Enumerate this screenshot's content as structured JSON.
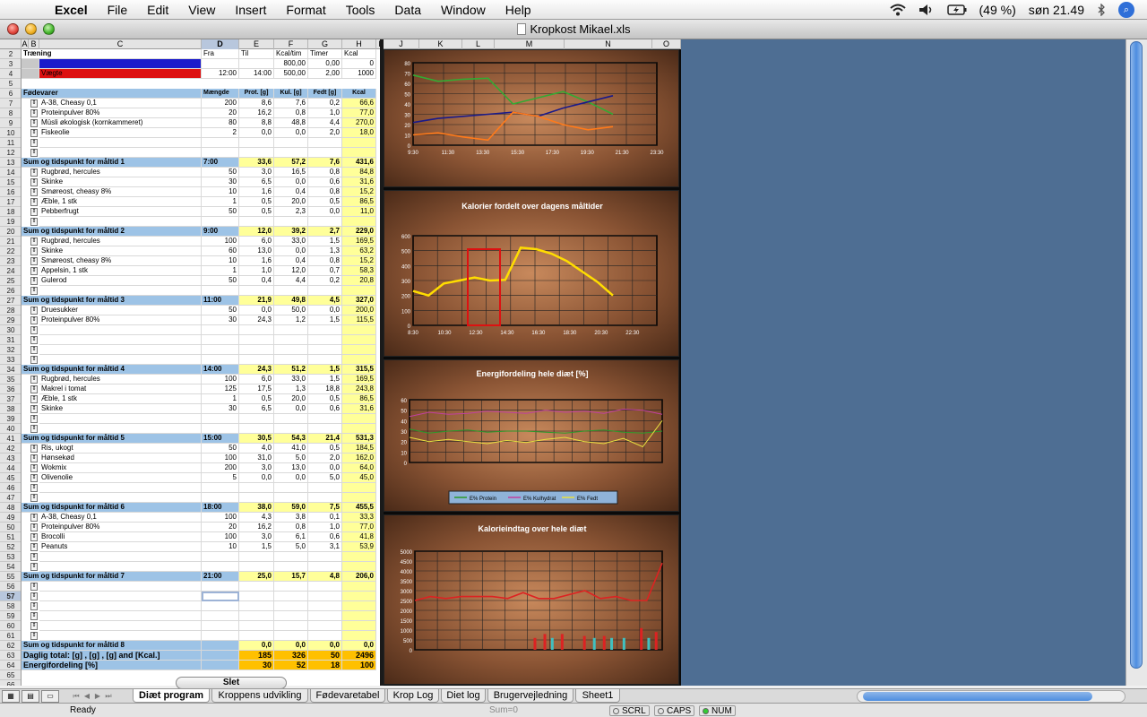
{
  "menubar": {
    "app": "Excel",
    "items": [
      "File",
      "Edit",
      "View",
      "Insert",
      "Format",
      "Tools",
      "Data",
      "Window",
      "Help"
    ],
    "battery": "(49 %)",
    "clock": "søn 21.49"
  },
  "window": {
    "title": "Kropkost Mikael.xls"
  },
  "columns": [
    "A",
    "B",
    "C",
    "D",
    "E",
    "F",
    "G",
    "H",
    "I",
    "J",
    "K",
    "L",
    "M",
    "N",
    "O"
  ],
  "training": {
    "label": "Træning",
    "headers": [
      "Fra",
      "Til",
      "Kcal/tim",
      "Timer",
      "Kcal"
    ],
    "row3": [
      "",
      "",
      "800,00",
      "0,00",
      "0"
    ],
    "row4_label": "Vægte",
    "row4": [
      "12:00",
      "14:00",
      "500,00",
      "2,00",
      "1000"
    ]
  },
  "food_header": {
    "label": "Fødevarer",
    "cols": [
      "Mængde",
      "Prot. [g]",
      "Kul. [g]",
      "Fedt [g]",
      "Kcal"
    ]
  },
  "rows": [
    {
      "r": 7,
      "name": "A-38, Cheasy 0,1",
      "d": "200",
      "e": "8,6",
      "f": "7,6",
      "g": "0,2",
      "h": "66,6"
    },
    {
      "r": 8,
      "name": "Proteinpulver 80%",
      "d": "20",
      "e": "16,2",
      "f": "0,8",
      "g": "1,0",
      "h": "77,0"
    },
    {
      "r": 9,
      "name": "Müsli økologisk (kornkammeret)",
      "d": "80",
      "e": "8,8",
      "f": "48,8",
      "g": "4,4",
      "h": "270,0"
    },
    {
      "r": 10,
      "name": "Fiskeolie",
      "d": "2",
      "e": "0,0",
      "f": "0,0",
      "g": "2,0",
      "h": "18,0"
    },
    {
      "r": 11,
      "name": "",
      "d": "",
      "e": "",
      "f": "",
      "g": "",
      "h": ""
    },
    {
      "r": 12,
      "name": "",
      "d": "",
      "e": "",
      "f": "",
      "g": "",
      "h": ""
    },
    {
      "r": 13,
      "hdr": true,
      "name": "Sum og tidspunkt for måltid 1",
      "d": "7:00",
      "e": "33,6",
      "f": "57,2",
      "g": "7,6",
      "h": "431,6"
    },
    {
      "r": 14,
      "name": "Rugbrød, hercules",
      "d": "50",
      "e": "3,0",
      "f": "16,5",
      "g": "0,8",
      "h": "84,8"
    },
    {
      "r": 15,
      "name": "Skinke",
      "d": "30",
      "e": "6,5",
      "f": "0,0",
      "g": "0,6",
      "h": "31,6"
    },
    {
      "r": 16,
      "name": "Smøreost, cheasy 8%",
      "d": "10",
      "e": "1,6",
      "f": "0,4",
      "g": "0,8",
      "h": "15,2"
    },
    {
      "r": 17,
      "name": "Æble, 1 stk",
      "d": "1",
      "e": "0,5",
      "f": "20,0",
      "g": "0,5",
      "h": "86,5"
    },
    {
      "r": 18,
      "name": "Pebberfrugt",
      "d": "50",
      "e": "0,5",
      "f": "2,3",
      "g": "0,0",
      "h": "11,0"
    },
    {
      "r": 19,
      "name": "",
      "d": "",
      "e": "",
      "f": "",
      "g": "",
      "h": ""
    },
    {
      "r": 20,
      "hdr": true,
      "name": "Sum og tidspunkt for måltid 2",
      "d": "9:00",
      "e": "12,0",
      "f": "39,2",
      "g": "2,7",
      "h": "229,0"
    },
    {
      "r": 21,
      "name": "Rugbrød, hercules",
      "d": "100",
      "e": "6,0",
      "f": "33,0",
      "g": "1,5",
      "h": "169,5"
    },
    {
      "r": 22,
      "name": "Skinke",
      "d": "60",
      "e": "13,0",
      "f": "0,0",
      "g": "1,3",
      "h": "63,2"
    },
    {
      "r": 23,
      "name": "Smøreost, cheasy 8%",
      "d": "10",
      "e": "1,6",
      "f": "0,4",
      "g": "0,8",
      "h": "15,2"
    },
    {
      "r": 24,
      "name": "Appelsin, 1 stk",
      "d": "1",
      "e": "1,0",
      "f": "12,0",
      "g": "0,7",
      "h": "58,3"
    },
    {
      "r": 25,
      "name": "Gulerod",
      "d": "50",
      "e": "0,4",
      "f": "4,4",
      "g": "0,2",
      "h": "20,8"
    },
    {
      "r": 26,
      "name": "",
      "d": "",
      "e": "",
      "f": "",
      "g": "",
      "h": ""
    },
    {
      "r": 27,
      "hdr": true,
      "name": "Sum og tidspunkt for måltid 3",
      "d": "11:00",
      "e": "21,9",
      "f": "49,8",
      "g": "4,5",
      "h": "327,0"
    },
    {
      "r": 28,
      "name": "Druesukker",
      "d": "50",
      "e": "0,0",
      "f": "50,0",
      "g": "0,0",
      "h": "200,0"
    },
    {
      "r": 29,
      "name": "Proteinpulver 80%",
      "d": "30",
      "e": "24,3",
      "f": "1,2",
      "g": "1,5",
      "h": "115,5"
    },
    {
      "r": 30,
      "name": "",
      "d": "",
      "e": "",
      "f": "",
      "g": "",
      "h": ""
    },
    {
      "r": 31,
      "name": "",
      "d": "",
      "e": "",
      "f": "",
      "g": "",
      "h": ""
    },
    {
      "r": 32,
      "name": "",
      "d": "",
      "e": "",
      "f": "",
      "g": "",
      "h": ""
    },
    {
      "r": 33,
      "name": "",
      "d": "",
      "e": "",
      "f": "",
      "g": "",
      "h": ""
    },
    {
      "r": 34,
      "hdr": true,
      "name": "Sum og tidspunkt for måltid 4",
      "d": "14:00",
      "e": "24,3",
      "f": "51,2",
      "g": "1,5",
      "h": "315,5"
    },
    {
      "r": 35,
      "name": "Rugbrød, hercules",
      "d": "100",
      "e": "6,0",
      "f": "33,0",
      "g": "1,5",
      "h": "169,5"
    },
    {
      "r": 36,
      "name": "Makrel i tomat",
      "d": "125",
      "e": "17,5",
      "f": "1,3",
      "g": "18,8",
      "h": "243,8"
    },
    {
      "r": 37,
      "name": "Æble, 1 stk",
      "d": "1",
      "e": "0,5",
      "f": "20,0",
      "g": "0,5",
      "h": "86,5"
    },
    {
      "r": 38,
      "name": "Skinke",
      "d": "30",
      "e": "6,5",
      "f": "0,0",
      "g": "0,6",
      "h": "31,6"
    },
    {
      "r": 39,
      "name": "",
      "d": "",
      "e": "",
      "f": "",
      "g": "",
      "h": ""
    },
    {
      "r": 40,
      "name": "",
      "d": "",
      "e": "",
      "f": "",
      "g": "",
      "h": ""
    },
    {
      "r": 41,
      "hdr": true,
      "name": "Sum og tidspunkt for måltid 5",
      "d": "15:00",
      "e": "30,5",
      "f": "54,3",
      "g": "21,4",
      "h": "531,3"
    },
    {
      "r": 42,
      "name": "Ris, ukogt",
      "d": "50",
      "e": "4,0",
      "f": "41,0",
      "g": "0,5",
      "h": "184,5"
    },
    {
      "r": 43,
      "name": "Hønsekød",
      "d": "100",
      "e": "31,0",
      "f": "5,0",
      "g": "2,0",
      "h": "162,0"
    },
    {
      "r": 44,
      "name": "Wokmix",
      "d": "200",
      "e": "3,0",
      "f": "13,0",
      "g": "0,0",
      "h": "64,0"
    },
    {
      "r": 45,
      "name": "Olivenolie",
      "d": "5",
      "e": "0,0",
      "f": "0,0",
      "g": "5,0",
      "h": "45,0"
    },
    {
      "r": 46,
      "name": "",
      "d": "",
      "e": "",
      "f": "",
      "g": "",
      "h": ""
    },
    {
      "r": 47,
      "name": "",
      "d": "",
      "e": "",
      "f": "",
      "g": "",
      "h": ""
    },
    {
      "r": 48,
      "hdr": true,
      "name": "Sum og tidspunkt for måltid 6",
      "d": "18:00",
      "e": "38,0",
      "f": "59,0",
      "g": "7,5",
      "h": "455,5"
    },
    {
      "r": 49,
      "name": "A-38, Cheasy 0,1",
      "d": "100",
      "e": "4,3",
      "f": "3,8",
      "g": "0,1",
      "h": "33,3"
    },
    {
      "r": 50,
      "name": "Proteinpulver 80%",
      "d": "20",
      "e": "16,2",
      "f": "0,8",
      "g": "1,0",
      "h": "77,0"
    },
    {
      "r": 51,
      "name": "Brocolli",
      "d": "100",
      "e": "3,0",
      "f": "6,1",
      "g": "0,6",
      "h": "41,8"
    },
    {
      "r": 52,
      "name": "Peanuts",
      "d": "10",
      "e": "1,5",
      "f": "5,0",
      "g": "3,1",
      "h": "53,9"
    },
    {
      "r": 53,
      "name": "",
      "d": "",
      "e": "",
      "f": "",
      "g": "",
      "h": ""
    },
    {
      "r": 54,
      "name": "",
      "d": "",
      "e": "",
      "f": "",
      "g": "",
      "h": ""
    },
    {
      "r": 55,
      "hdr": true,
      "name": "Sum og tidspunkt for måltid 7",
      "d": "21:00",
      "e": "25,0",
      "f": "15,7",
      "g": "4,8",
      "h": "206,0"
    },
    {
      "r": 56,
      "name": "",
      "d": "",
      "e": "",
      "f": "",
      "g": "",
      "h": ""
    },
    {
      "r": 57,
      "name": "",
      "d": "",
      "e": "",
      "f": "",
      "g": "",
      "h": ""
    },
    {
      "r": 58,
      "name": "",
      "d": "",
      "e": "",
      "f": "",
      "g": "",
      "h": ""
    },
    {
      "r": 59,
      "name": "",
      "d": "",
      "e": "",
      "f": "",
      "g": "",
      "h": ""
    },
    {
      "r": 60,
      "name": "",
      "d": "",
      "e": "",
      "f": "",
      "g": "",
      "h": ""
    },
    {
      "r": 61,
      "name": "",
      "d": "",
      "e": "",
      "f": "",
      "g": "",
      "h": ""
    },
    {
      "r": 62,
      "hdr": true,
      "name": "Sum og tidspunkt for måltid 8",
      "d": "",
      "e": "0,0",
      "f": "0,0",
      "g": "0,0",
      "h": "0,0"
    },
    {
      "r": 63,
      "total": true,
      "name": "Daglig total: [g] , [g] , [g] and [Kcal.]",
      "d": "",
      "e": "185",
      "f": "326",
      "g": "50",
      "h": "2496"
    },
    {
      "r": 64,
      "total": true,
      "name": "Energifordeling  [%]",
      "d": "",
      "e": "30",
      "f": "52",
      "g": "18",
      "h": "100"
    }
  ],
  "charts": {
    "c1": {
      "yticks": [
        "80",
        "70",
        "60",
        "50",
        "40",
        "30",
        "20",
        "10",
        "0"
      ],
      "xticks": [
        "9:30",
        "11:30",
        "13:30",
        "15:30",
        "17:30",
        "19:30",
        "21:30",
        "23:30"
      ]
    },
    "c2": {
      "title": "Kalorier fordelt over dagens måltider",
      "yticks": [
        "600",
        "500",
        "400",
        "300",
        "200",
        "100",
        "0"
      ],
      "xticks": [
        "8:30",
        "10:30",
        "12:30",
        "14:30",
        "16:30",
        "18:30",
        "20:30",
        "22:30"
      ]
    },
    "c3": {
      "title": "Energifordeling hele diæt [%]",
      "yticks": [
        "60",
        "50",
        "40",
        "30",
        "20",
        "10",
        "0"
      ],
      "legend": [
        "E% Protein",
        "E% Kulhydrat",
        "E% Fedt"
      ]
    },
    "c4": {
      "title": "Kalorieindtag over hele diæt",
      "yticks": [
        "5000",
        "4500",
        "4000",
        "3500",
        "3000",
        "2500",
        "2000",
        "1500",
        "1000",
        "500",
        "0"
      ]
    }
  },
  "chart_data": [
    {
      "type": "line",
      "x": [
        "9:30",
        "11:30",
        "13:30",
        "15:30",
        "17:30",
        "19:30",
        "21:30",
        "23:30"
      ],
      "series": [
        {
          "values": [
            68,
            62,
            64,
            65,
            40,
            46,
            52,
            42,
            30
          ],
          "color": "#33aa33"
        },
        {
          "values": [
            22,
            26,
            28,
            30,
            32,
            28,
            36,
            42,
            48
          ],
          "color": "#1a1a8a"
        },
        {
          "values": [
            10,
            12,
            8,
            5,
            32,
            28,
            20,
            15,
            18
          ],
          "color": "#ff7a1a"
        }
      ],
      "ylim": [
        0,
        80
      ]
    },
    {
      "type": "line",
      "title": "Kalorier fordelt over dagens måltider",
      "x": [
        "8:30",
        "10:30",
        "12:30",
        "14:30",
        "16:30",
        "18:30",
        "20:30",
        "22:30"
      ],
      "series": [
        {
          "values": [
            230,
            200,
            280,
            300,
            320,
            300,
            305,
            520,
            510,
            480,
            430,
            360,
            290,
            200
          ],
          "color": "#ffdd00"
        }
      ],
      "ylim": [
        0,
        600
      ]
    },
    {
      "type": "line",
      "title": "Energifordeling hele diæt [%]",
      "series": [
        {
          "name": "E% Protein",
          "values": [
            32,
            28,
            30,
            31,
            29,
            30,
            30,
            29,
            28,
            30,
            31,
            29,
            28,
            30
          ],
          "color": "#2a9a2a"
        },
        {
          "name": "E% Kulhydrat",
          "values": [
            44,
            48,
            46,
            47,
            49,
            48,
            47,
            50,
            48,
            49,
            47,
            51,
            50,
            46
          ],
          "color": "#c040a0"
        },
        {
          "name": "E% Fedt",
          "values": [
            24,
            20,
            22,
            20,
            18,
            21,
            19,
            22,
            24,
            20,
            18,
            23,
            15,
            40
          ],
          "color": "#e8e040"
        }
      ],
      "ylim": [
        0,
        60
      ]
    },
    {
      "type": "line",
      "title": "Kalorieindtag over hele diæt",
      "series": [
        {
          "values": [
            2500,
            2700,
            2600,
            2700,
            2700,
            2700,
            2600,
            2900,
            2600,
            2600,
            2800,
            3000,
            2600,
            2700,
            2500,
            2500,
            4400
          ],
          "color": "#dd2222"
        }
      ],
      "ylim": [
        0,
        5000
      ]
    }
  ],
  "tabs": [
    "Diæt program",
    "Kroppens udvikling",
    "Fødevaretabel",
    "Krop Log",
    "Diet log",
    "Brugervejledning",
    "Sheet1"
  ],
  "delete_label": "Slet",
  "status": {
    "ready": "Ready",
    "sum": "Sum=0",
    "scrl": "SCRL",
    "caps": "CAPS",
    "num": "NUM"
  }
}
